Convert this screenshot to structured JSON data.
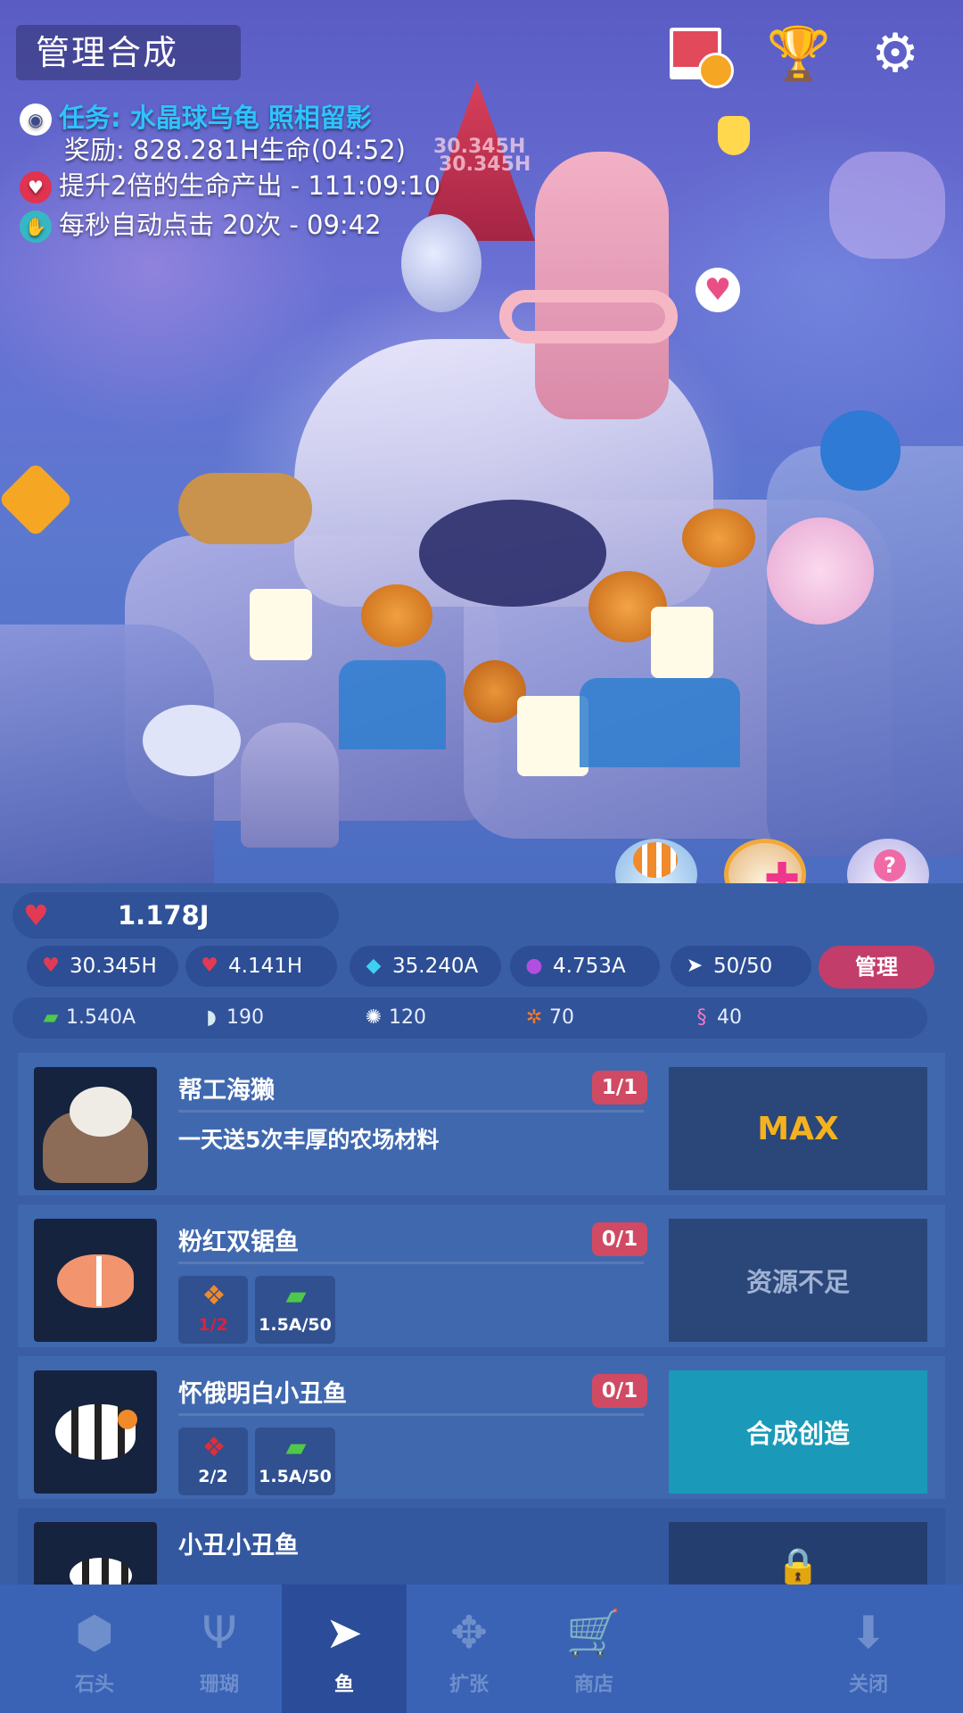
{
  "header": {
    "title": "管理合成"
  },
  "quests": [
    {
      "icon": "camera-icon",
      "text": "任务: 水晶球乌龟 照相留影",
      "sub": "奖励: 828.281H生命(04:52)"
    },
    {
      "icon": "heart-boost-icon",
      "text": "提升2倍的生命产出 - 111:09:10"
    },
    {
      "icon": "auto-tap-icon",
      "text": "每秒自动点击 20次 - 09:42"
    }
  ],
  "floating": [
    "30.345H",
    "30.345H"
  ],
  "life": {
    "value": "1.178J"
  },
  "resources": [
    {
      "icon": "heart-tap-icon",
      "value": "30.345H"
    },
    {
      "icon": "heart-timer-icon",
      "value": "4.141H"
    },
    {
      "icon": "diamond-icon",
      "value": "35.240A"
    },
    {
      "icon": "pearl-icon",
      "value": "4.753A"
    },
    {
      "icon": "fish-icon",
      "value": "50/50"
    }
  ],
  "manage_label": "管理",
  "materials": [
    {
      "icon": "seaweed-icon",
      "value": "1.540A"
    },
    {
      "icon": "shell-icon",
      "value": "190"
    },
    {
      "icon": "urchin-icon",
      "value": "120"
    },
    {
      "icon": "crab-icon",
      "value": "70"
    },
    {
      "icon": "seahorse-icon",
      "value": "40"
    }
  ],
  "cards": [
    {
      "name": "帮工海獭",
      "count": "1/1",
      "desc": "一天送5次丰厚的农场材料",
      "action": "MAX"
    },
    {
      "name": "粉红双锯鱼",
      "count": "0/1",
      "req1": "1/2",
      "req2": "1.5A/50",
      "action": "资源不足"
    },
    {
      "name": "怀俄明白小丑鱼",
      "count": "0/1",
      "req1": "2/2",
      "req2": "1.5A/50",
      "action": "合成创造"
    },
    {
      "name": "小丑小丑鱼",
      "action_icon": "lock-icon"
    }
  ],
  "tabs": [
    {
      "label": "石头",
      "icon": "stone-icon"
    },
    {
      "label": "珊瑚",
      "icon": "coral-icon"
    },
    {
      "label": "鱼",
      "icon": "fish-icon"
    },
    {
      "label": "扩张",
      "icon": "expand-icon"
    },
    {
      "label": "商店",
      "icon": "cart-icon"
    },
    {
      "label": "关闭",
      "icon": "close-down-icon"
    }
  ],
  "colors": {
    "accent_red": "#d04a63",
    "craft_teal": "#1a9ab8",
    "max_gold": "#f5b21e"
  }
}
